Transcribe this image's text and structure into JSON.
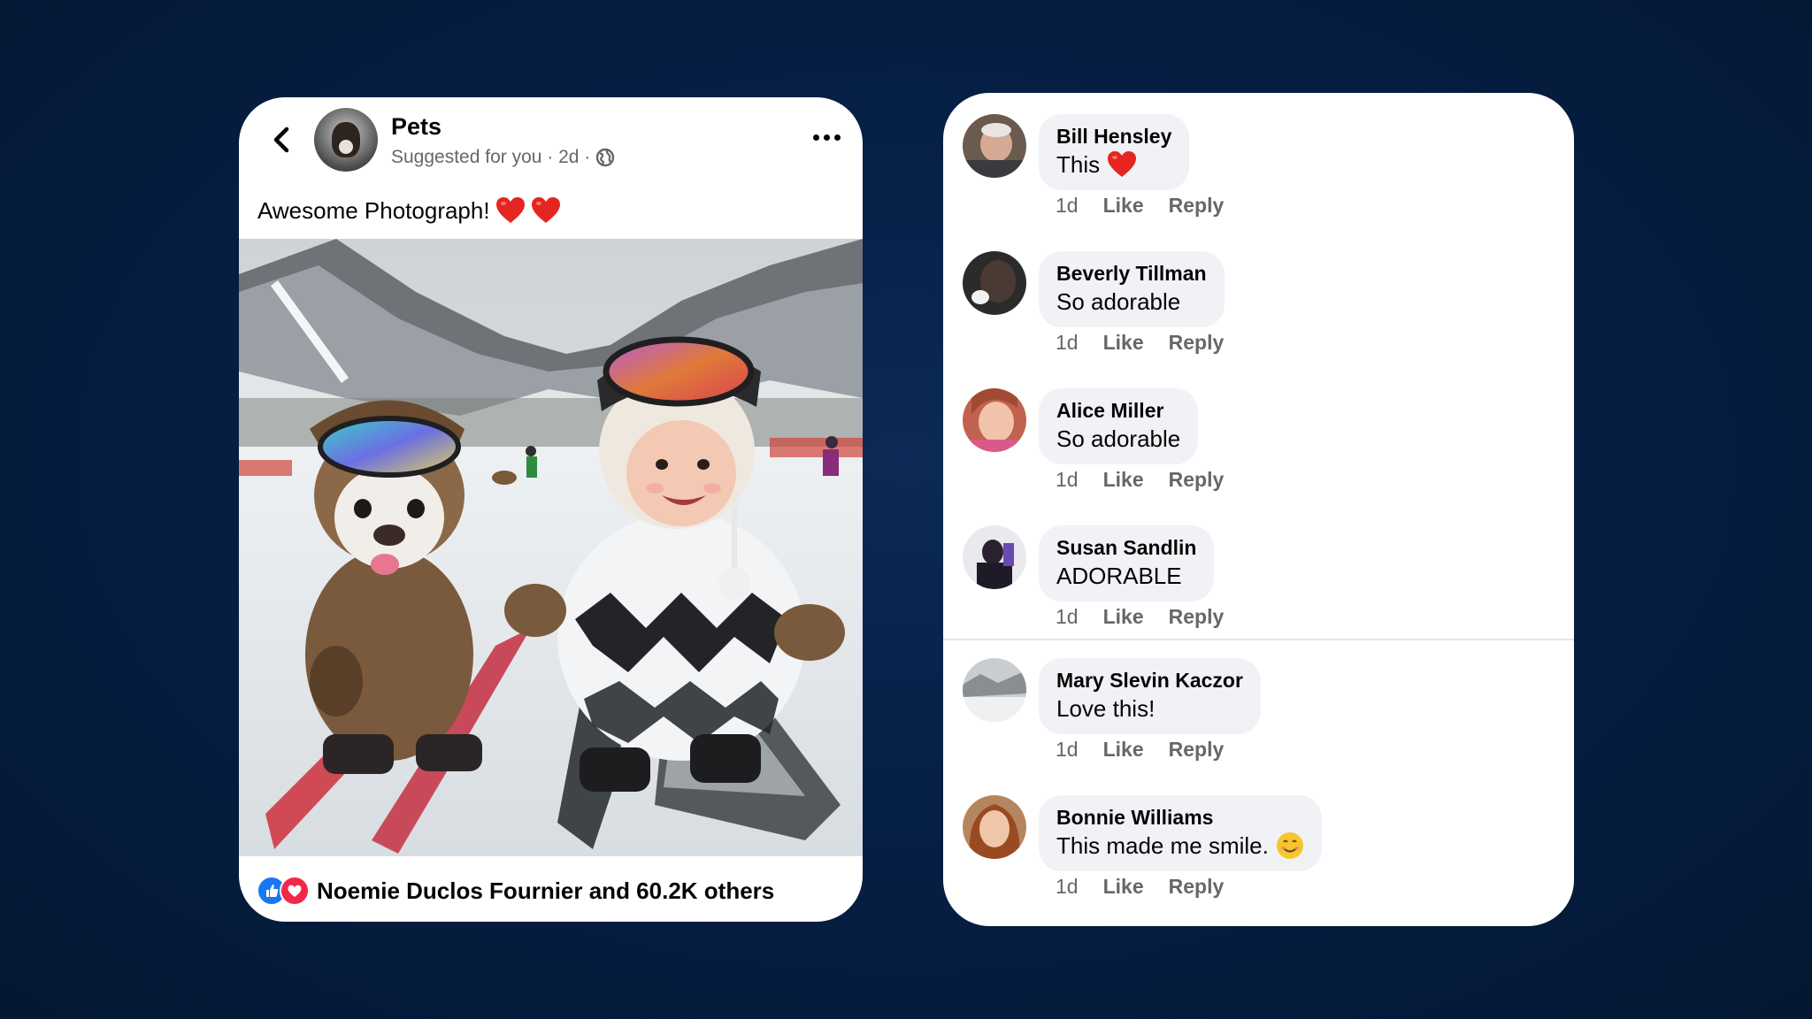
{
  "post": {
    "page_name": "Pets",
    "meta": "Suggested for you · 2d ·",
    "caption": "Awesome Photograph!",
    "reactions_text": "Noemie Duclos Fournier and 60.2K others"
  },
  "comments": [
    {
      "name": "Bill Hensley",
      "text": "This",
      "time": "1d",
      "like": "Like",
      "reply": "Reply"
    },
    {
      "name": "Beverly Tillman",
      "text": "So adorable",
      "time": "1d",
      "like": "Like",
      "reply": "Reply"
    },
    {
      "name": "Alice Miller",
      "text": "So adorable",
      "time": "1d",
      "like": "Like",
      "reply": "Reply"
    },
    {
      "name": "Susan Sandlin",
      "text": "ADORABLE",
      "time": "1d",
      "like": "Like",
      "reply": "Reply"
    },
    {
      "name": "Mary Slevin Kaczor",
      "text": "Love this!",
      "time": "1d",
      "like": "Like",
      "reply": "Reply"
    },
    {
      "name": "Bonnie Williams",
      "text": "This made me smile.",
      "time": "1d",
      "like": "Like",
      "reply": "Reply"
    }
  ],
  "colors": {
    "background": "#061f45",
    "card": "#ffffff",
    "bubble": "#f0f2f5",
    "muted_text": "#65676b",
    "like_blue": "#1877f2",
    "love_red": "#f0284a"
  },
  "icons": [
    "back-arrow-icon",
    "globe-icon",
    "more-dots-icon",
    "heart-icon",
    "like-reaction-icon",
    "love-reaction-icon",
    "smile-emoji-icon"
  ]
}
